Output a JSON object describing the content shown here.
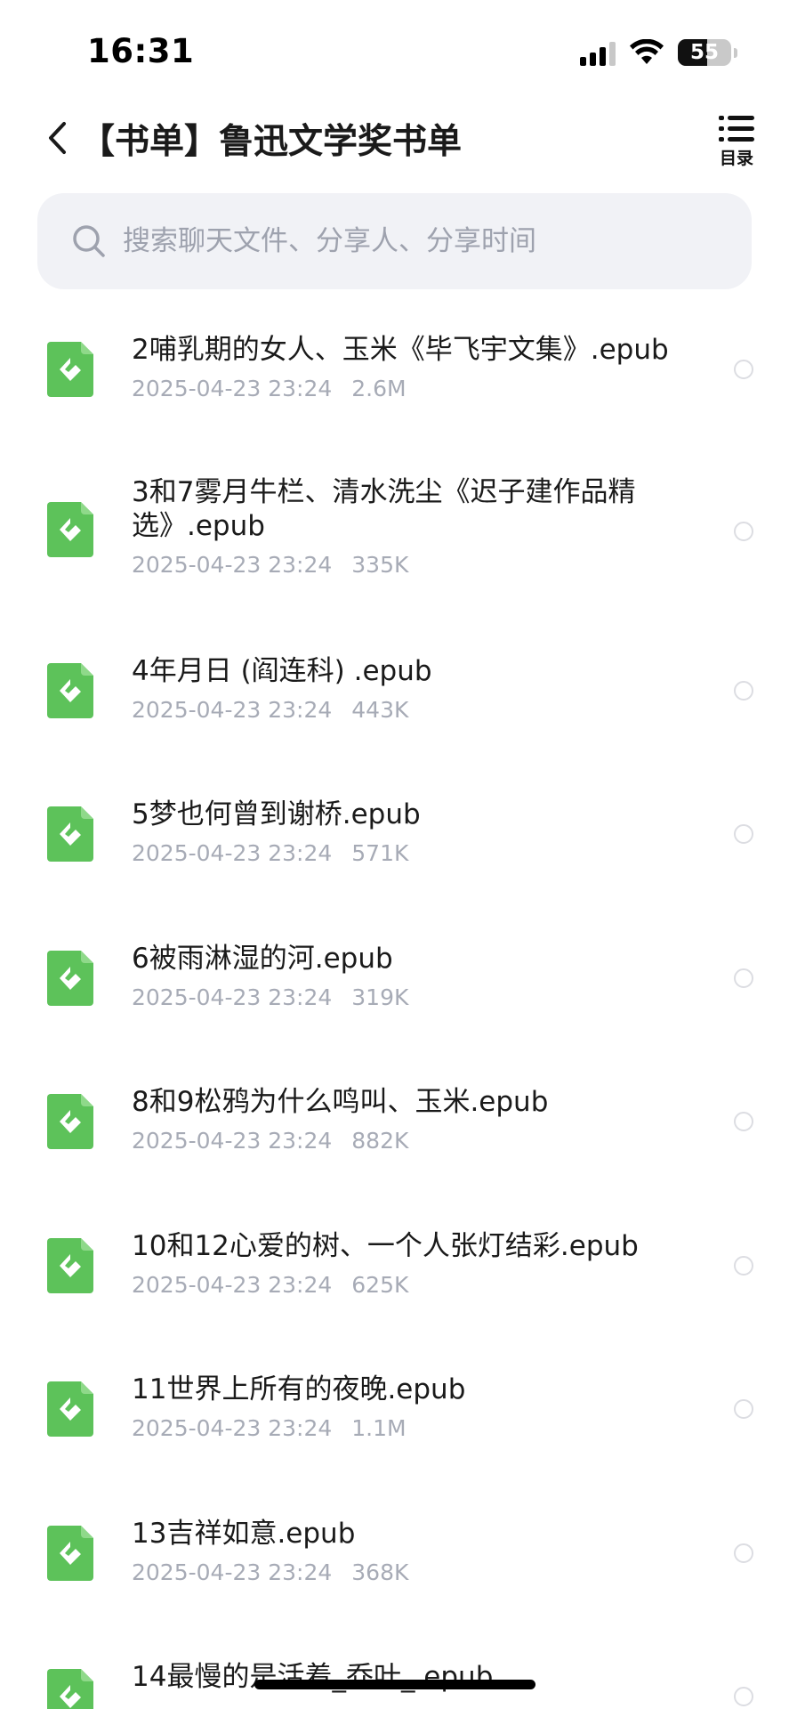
{
  "status_bar": {
    "time": "16:31",
    "battery": "55",
    "battery_level": 0.55
  },
  "header": {
    "title": "【书单】鲁迅文学奖书单",
    "toc_label": "目录"
  },
  "search": {
    "placeholder": "搜索聊天文件、分享人、分享时间",
    "value": ""
  },
  "icons": {
    "back": "chevron-left-icon",
    "toc": "list-icon",
    "search": "search-icon",
    "file": "epub-file-icon"
  },
  "colors": {
    "epub_green": "#5dc25a",
    "meta_gray": "#a7abb6",
    "search_bg": "#f1f2f6"
  },
  "files": [
    {
      "name": "2哺乳期的女人、玉米《毕飞宇文集》.epub",
      "date": "2025-04-23 23:24",
      "size": "2.6M"
    },
    {
      "name": "3和7雾月牛栏、清水洗尘《迟子建作品精选》.epub",
      "date": "2025-04-23 23:24",
      "size": "335K"
    },
    {
      "name": "4年月日 (阎连科) .epub",
      "date": "2025-04-23 23:24",
      "size": "443K"
    },
    {
      "name": "5梦也何曾到谢桥.epub",
      "date": "2025-04-23 23:24",
      "size": "571K"
    },
    {
      "name": "6被雨淋湿的河.epub",
      "date": "2025-04-23 23:24",
      "size": "319K"
    },
    {
      "name": "8和9松鸦为什么鸣叫、玉米.epub",
      "date": "2025-04-23 23:24",
      "size": "882K"
    },
    {
      "name": "10和12心爱的树、一个人张灯结彩.epub",
      "date": "2025-04-23 23:24",
      "size": "625K"
    },
    {
      "name": "11世界上所有的夜晚.epub",
      "date": "2025-04-23 23:24",
      "size": "1.1M"
    },
    {
      "name": "13吉祥如意.epub",
      "date": "2025-04-23 23:24",
      "size": "368K"
    },
    {
      "name": "14最慢的是活着_乔叶_.epub",
      "date": "",
      "size": ""
    }
  ]
}
